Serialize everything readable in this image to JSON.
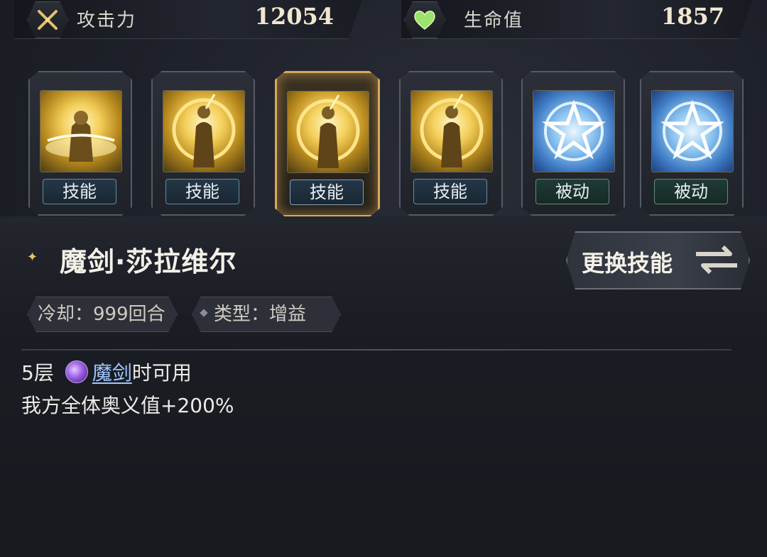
{
  "stats": {
    "attack": {
      "label": "攻击力",
      "value": "12054",
      "icon": "crossed-swords-icon"
    },
    "hp": {
      "label": "生命值",
      "value": "1857",
      "icon": "green-heart-icon"
    }
  },
  "skill_slots": [
    {
      "tag": "技能",
      "art": "golden-warrior-art",
      "selected": false
    },
    {
      "tag": "技能",
      "art": "golden-ring-warrior-art",
      "selected": false
    },
    {
      "tag": "技能",
      "art": "golden-ring-warrior-art",
      "selected": true
    },
    {
      "tag": "技能",
      "art": "golden-ring-warrior-art",
      "selected": false
    },
    {
      "tag": "被动",
      "art": "blue-star-art",
      "selected": false
    },
    {
      "tag": "被动",
      "art": "blue-star-art",
      "selected": false
    }
  ],
  "detail": {
    "name": "魔剑·莎拉维尔",
    "swap_button": "更换技能",
    "cooldown_chip": "冷却：999回合",
    "type_chip": "类型：增益",
    "desc_prefix": "5层",
    "desc_link": "魔剑",
    "desc_suffix": "时可用",
    "desc_line2": "我方全体奥义值+200%"
  },
  "colors": {
    "accent_gold": "#d7a85a",
    "link_blue": "#9fc6ff",
    "hp_green": "#9be36b"
  }
}
